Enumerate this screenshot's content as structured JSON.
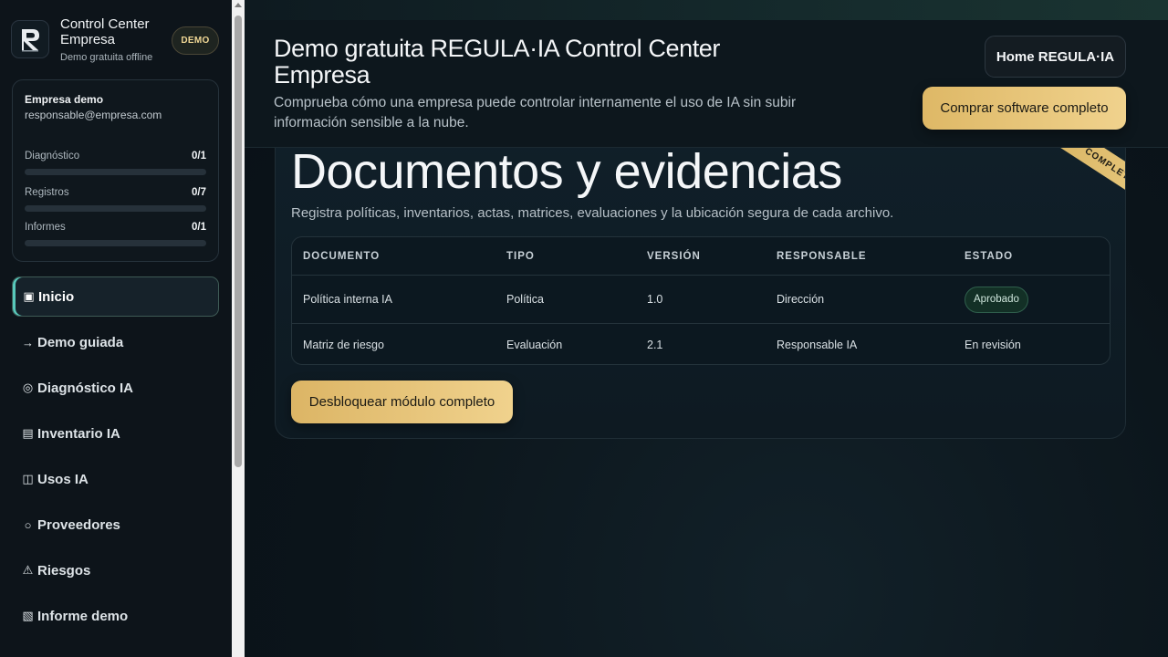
{
  "sidebar": {
    "brand_title": "Control Center Empresa",
    "brand_subtitle": "Demo gratuita offline",
    "badge": "DEMO",
    "company": {
      "name": "Empresa demo",
      "email": "responsable@empresa.com"
    },
    "progress": [
      {
        "label": "Diagnóstico",
        "value": "0/1",
        "fraction": 0
      },
      {
        "label": "Registros",
        "value": "0/7",
        "fraction": 0
      },
      {
        "label": "Informes",
        "value": "0/1",
        "fraction": 0
      }
    ],
    "nav": [
      {
        "icon": "▣",
        "label": "Inicio",
        "active": true
      },
      {
        "icon": "→",
        "label": "Demo guiada"
      },
      {
        "icon": "◎",
        "label": "Diagnóstico IA"
      },
      {
        "icon": "▤",
        "label": "Inventario IA"
      },
      {
        "icon": "◫",
        "label": "Usos IA"
      },
      {
        "icon": "○",
        "label": "Proveedores"
      },
      {
        "icon": "⚠",
        "label": "Riesgos"
      },
      {
        "icon": "▧",
        "label": "Informe demo"
      }
    ]
  },
  "header": {
    "title": "Demo gratuita REGULA·IA Control Center Empresa",
    "description": "Comprueba cómo una empresa puede controlar internamente el uso de IA sin subir información sensible a la nube.",
    "home_button": "Home REGULA·IA",
    "buy_button": "Comprar software completo"
  },
  "section": {
    "ribbon": "COMPLETO",
    "title": "Documentos y evidencias",
    "description": "Registra políticas, inventarios, actas, matrices, evaluaciones y la ubicación segura de cada archivo.",
    "columns": [
      "DOCUMENTO",
      "TIPO",
      "VERSIÓN",
      "RESPONSABLE",
      "ESTADO"
    ],
    "rows": [
      [
        "Política interna IA",
        "Política",
        "1.0",
        "Dirección",
        "Aprobado"
      ],
      [
        "Matriz de riesgo",
        "Evaluación",
        "2.1",
        "Responsable IA",
        "En revisión"
      ]
    ],
    "unlock_button": "Desbloquear módulo completo"
  },
  "colors": {
    "accent_gold": "#e6c476",
    "accent_teal": "#58c9bb",
    "background": "#0b1218"
  }
}
